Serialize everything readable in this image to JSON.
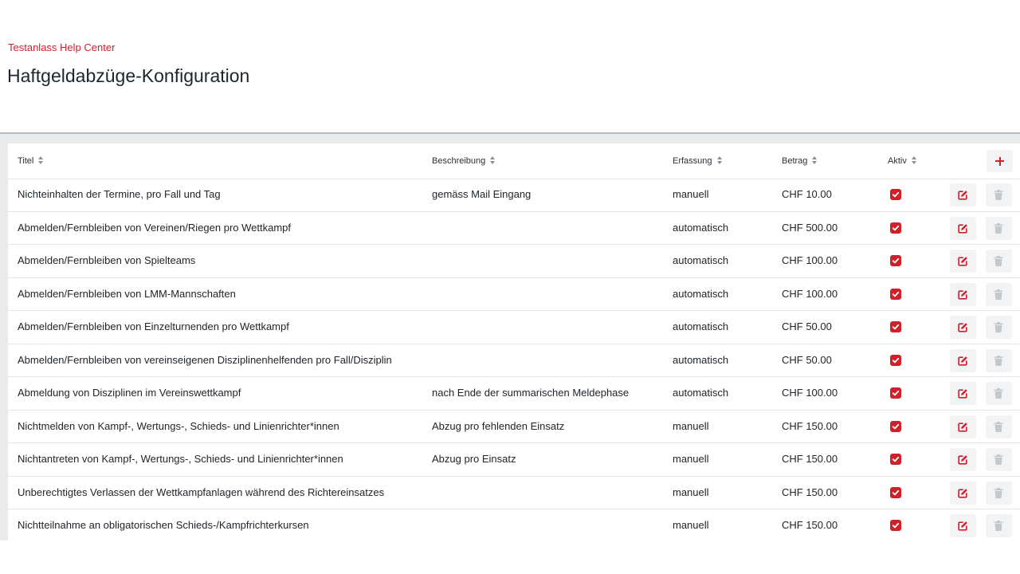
{
  "header": {
    "breadcrumb": "Testanlass Help Center",
    "title": "Haftgeldabzüge-Konfiguration"
  },
  "table": {
    "columns": {
      "titel": "Titel",
      "beschreibung": "Beschreibung",
      "erfassung": "Erfassung",
      "betrag": "Betrag",
      "aktiv": "Aktiv"
    },
    "rows": [
      {
        "titel": "Nichteinhalten der Termine, pro Fall und Tag",
        "beschreibung": "gemäss Mail Eingang",
        "erfassung": "manuell",
        "betrag": "CHF 10.00",
        "aktiv": true
      },
      {
        "titel": "Abmelden/Fernbleiben von Vereinen/Riegen pro Wettkampf",
        "beschreibung": "",
        "erfassung": "automatisch",
        "betrag": "CHF 500.00",
        "aktiv": true
      },
      {
        "titel": "Abmelden/Fernbleiben von Spielteams",
        "beschreibung": "",
        "erfassung": "automatisch",
        "betrag": "CHF 100.00",
        "aktiv": true
      },
      {
        "titel": "Abmelden/Fernbleiben von LMM-Mannschaften",
        "beschreibung": "",
        "erfassung": "automatisch",
        "betrag": "CHF 100.00",
        "aktiv": true
      },
      {
        "titel": "Abmelden/Fernbleiben von Einzelturnenden pro Wettkampf",
        "beschreibung": "",
        "erfassung": "automatisch",
        "betrag": "CHF 50.00",
        "aktiv": true
      },
      {
        "titel": "Abmelden/Fernbleiben von vereinseigenen Disziplinenhelfenden pro Fall/Disziplin",
        "beschreibung": "",
        "erfassung": "automatisch",
        "betrag": "CHF 50.00",
        "aktiv": true
      },
      {
        "titel": "Abmeldung von Disziplinen im Vereinswettkampf",
        "beschreibung": "nach Ende der summarischen Meldephase",
        "erfassung": "automatisch",
        "betrag": "CHF 100.00",
        "aktiv": true
      },
      {
        "titel": "Nichtmelden von Kampf-, Wertungs-, Schieds- und Linienrichter*innen",
        "beschreibung": "Abzug pro fehlenden Einsatz",
        "erfassung": "manuell",
        "betrag": "CHF 150.00",
        "aktiv": true
      },
      {
        "titel": "Nichtantreten von Kampf-, Wertungs-, Schieds- und Linienrichter*innen",
        "beschreibung": "Abzug pro Einsatz",
        "erfassung": "manuell",
        "betrag": "CHF 150.00",
        "aktiv": true
      },
      {
        "titel": "Unberechtigtes Verlassen der Wettkampfanlagen während des Richtereinsatzes",
        "beschreibung": "",
        "erfassung": "manuell",
        "betrag": "CHF 150.00",
        "aktiv": true
      },
      {
        "titel": "Nichtteilnahme an obligatorischen Schieds-/Kampfrichterkursen",
        "beschreibung": "",
        "erfassung": "manuell",
        "betrag": "CHF 150.00",
        "aktiv": true
      }
    ]
  },
  "icons": {
    "add": "plus-icon",
    "edit": "edit-icon",
    "delete": "trash-icon",
    "sort": "sort-icon",
    "checkbox": "checkbox-checked-icon"
  },
  "colors": {
    "accent": "#d0212b",
    "disabled_icon": "#c4c7cb",
    "button_bg": "#f2f3f5"
  }
}
